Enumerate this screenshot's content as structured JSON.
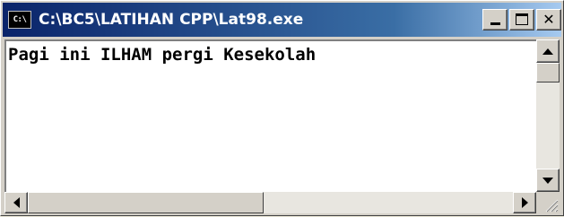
{
  "window": {
    "title": "C:\\BC5\\LATIHAN CPP\\Lat98.exe",
    "system_icon_text": "C:\\",
    "icons": {
      "system": "console-icon",
      "minimize": "minimize-icon",
      "maximize": "maximize-icon",
      "close": "close-icon",
      "close_glyph": "✕"
    }
  },
  "console": {
    "lines": [
      "Pagi ini ILHAM pergi Kesekolah"
    ]
  },
  "colors": {
    "titlebar_start": "#0a246a",
    "titlebar_end": "#a6caf0",
    "console_bg": "#ffffff",
    "console_text": "#000000",
    "chrome": "#d4d0c8"
  }
}
